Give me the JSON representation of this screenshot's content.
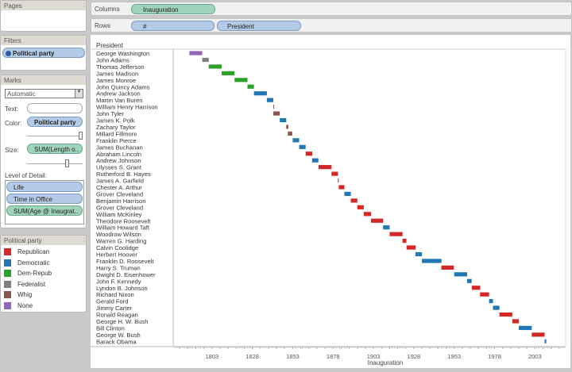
{
  "panels": {
    "pages": "Pages",
    "filters": "Filters",
    "filter_pill": "Political party",
    "marks": "Marks",
    "mark_type": "Automatic",
    "text_label": "Text:",
    "color_label": "Color:",
    "color_pill": "Political party",
    "size_label": "Size:",
    "size_pill": "SUM(Length o..",
    "lod_label": "Level of Detail:",
    "lod": [
      "Life",
      "Time in Office",
      "SUM(Age @ Inaugrat.."
    ]
  },
  "shelves": {
    "columns_label": "Columns",
    "columns_pill": "Inauguration",
    "rows_label": "Rows",
    "rows_pills": [
      "#",
      "President"
    ]
  },
  "legend": {
    "title": "Political party",
    "items": [
      {
        "label": "Republican",
        "color": "#d62728"
      },
      {
        "label": "Democratic",
        "color": "#1f77b4"
      },
      {
        "label": "Dem-Repub",
        "color": "#2ca02c"
      },
      {
        "label": "Federalist",
        "color": "#7f7f7f"
      },
      {
        "label": "Whig",
        "color": "#8c564b"
      },
      {
        "label": "None",
        "color": "#9467bd"
      }
    ]
  },
  "chart_data": {
    "type": "bar",
    "title": "",
    "ylabel": "President",
    "xlabel": "Inauguration",
    "xlim": [
      1779,
      2022
    ],
    "xticks": [
      "1803",
      "1828",
      "1853",
      "1878",
      "1903",
      "1928",
      "1953",
      "1978",
      "2003"
    ],
    "colors": {
      "Republican": "#d62728",
      "Democratic": "#1f77b4",
      "Dem-Repub": "#2ca02c",
      "Federalist": "#7f7f7f",
      "Whig": "#8c564b",
      "None": "#9467bd"
    },
    "rows": [
      {
        "president": "George Washington",
        "start": 1789,
        "years": 8,
        "party": "None"
      },
      {
        "president": "John Adams",
        "start": 1797,
        "years": 4,
        "party": "Federalist"
      },
      {
        "president": "Thomas Jefferson",
        "start": 1801,
        "years": 8,
        "party": "Dem-Repub"
      },
      {
        "president": "James Madison",
        "start": 1809,
        "years": 8,
        "party": "Dem-Repub"
      },
      {
        "president": "James Monroe",
        "start": 1817,
        "years": 8,
        "party": "Dem-Repub"
      },
      {
        "president": "John Quincy Adams",
        "start": 1825,
        "years": 4,
        "party": "Dem-Repub"
      },
      {
        "president": "Andrew Jackson",
        "start": 1829,
        "years": 8,
        "party": "Democratic"
      },
      {
        "president": "Martin Van Buren",
        "start": 1837,
        "years": 4,
        "party": "Democratic"
      },
      {
        "president": "William Henry Harrison",
        "start": 1841,
        "years": 0.1,
        "party": "Whig"
      },
      {
        "president": "John Tyler",
        "start": 1841,
        "years": 4,
        "party": "Whig"
      },
      {
        "president": "James K. Polk",
        "start": 1845,
        "years": 4,
        "party": "Democratic"
      },
      {
        "president": "Zachary Taylor",
        "start": 1849,
        "years": 1.3,
        "party": "Whig"
      },
      {
        "president": "Millard Fillmore",
        "start": 1850,
        "years": 2.7,
        "party": "Whig"
      },
      {
        "president": "Franklin Pierce",
        "start": 1853,
        "years": 4,
        "party": "Democratic"
      },
      {
        "president": "James Buchanan",
        "start": 1857,
        "years": 4,
        "party": "Democratic"
      },
      {
        "president": "Abraham Lincoln",
        "start": 1861,
        "years": 4.1,
        "party": "Republican"
      },
      {
        "president": "Andrew Johnson",
        "start": 1865,
        "years": 3.9,
        "party": "Democratic"
      },
      {
        "president": "Ulysses S. Grant",
        "start": 1869,
        "years": 8,
        "party": "Republican"
      },
      {
        "president": "Rutherford B. Hayes",
        "start": 1877,
        "years": 4,
        "party": "Republican"
      },
      {
        "president": "James A. Garfield",
        "start": 1881,
        "years": 0.5,
        "party": "Republican"
      },
      {
        "president": "Chester A. Arthur",
        "start": 1881.5,
        "years": 3.5,
        "party": "Republican"
      },
      {
        "president": "Grover Cleveland",
        "start": 1885,
        "years": 4,
        "party": "Democratic"
      },
      {
        "president": "Benjamin Harrison",
        "start": 1889,
        "years": 4,
        "party": "Republican"
      },
      {
        "president": "Grover Cleveland",
        "start": 1893,
        "years": 4,
        "party": "Republican"
      },
      {
        "president": "William McKinley",
        "start": 1897,
        "years": 4.5,
        "party": "Republican"
      },
      {
        "president": "Theodore Roosevelt",
        "start": 1901.5,
        "years": 7.5,
        "party": "Republican"
      },
      {
        "president": "William Howard Taft",
        "start": 1909,
        "years": 4,
        "party": "Democratic"
      },
      {
        "president": "Woodrow Wilson",
        "start": 1913,
        "years": 8,
        "party": "Republican"
      },
      {
        "president": "Warren G. Harding",
        "start": 1921,
        "years": 2.4,
        "party": "Republican"
      },
      {
        "president": "Calvin Coolidge",
        "start": 1923.5,
        "years": 5.6,
        "party": "Republican"
      },
      {
        "president": "Herbert Hoover",
        "start": 1929,
        "years": 4,
        "party": "Democratic"
      },
      {
        "president": "Franklin D. Roosevelt",
        "start": 1933,
        "years": 12.1,
        "party": "Democratic"
      },
      {
        "president": "Harry S. Truman",
        "start": 1945,
        "years": 7.8,
        "party": "Republican"
      },
      {
        "president": "Dwight D. Eisenhower",
        "start": 1953,
        "years": 8,
        "party": "Democratic"
      },
      {
        "president": "John F. Kennedy",
        "start": 1961,
        "years": 2.8,
        "party": "Democratic"
      },
      {
        "president": "Lyndon B. Johnson",
        "start": 1963.9,
        "years": 5.2,
        "party": "Republican"
      },
      {
        "president": "Richard Nixon",
        "start": 1969,
        "years": 5.6,
        "party": "Republican"
      },
      {
        "president": "Gerald Ford",
        "start": 1974.6,
        "years": 2.4,
        "party": "Democratic"
      },
      {
        "president": "Jimmy Carter",
        "start": 1977,
        "years": 4,
        "party": "Democratic"
      },
      {
        "president": "Ronald Reagan",
        "start": 1981,
        "years": 8,
        "party": "Republican"
      },
      {
        "president": "George H. W. Bush",
        "start": 1989,
        "years": 4,
        "party": "Republican"
      },
      {
        "president": "Bill Clinton",
        "start": 1993,
        "years": 8,
        "party": "Democratic"
      },
      {
        "president": "George W. Bush",
        "start": 2001,
        "years": 8,
        "party": "Republican"
      },
      {
        "president": "Barack Obama",
        "start": 2009,
        "years": 1,
        "party": "Democratic"
      }
    ]
  }
}
